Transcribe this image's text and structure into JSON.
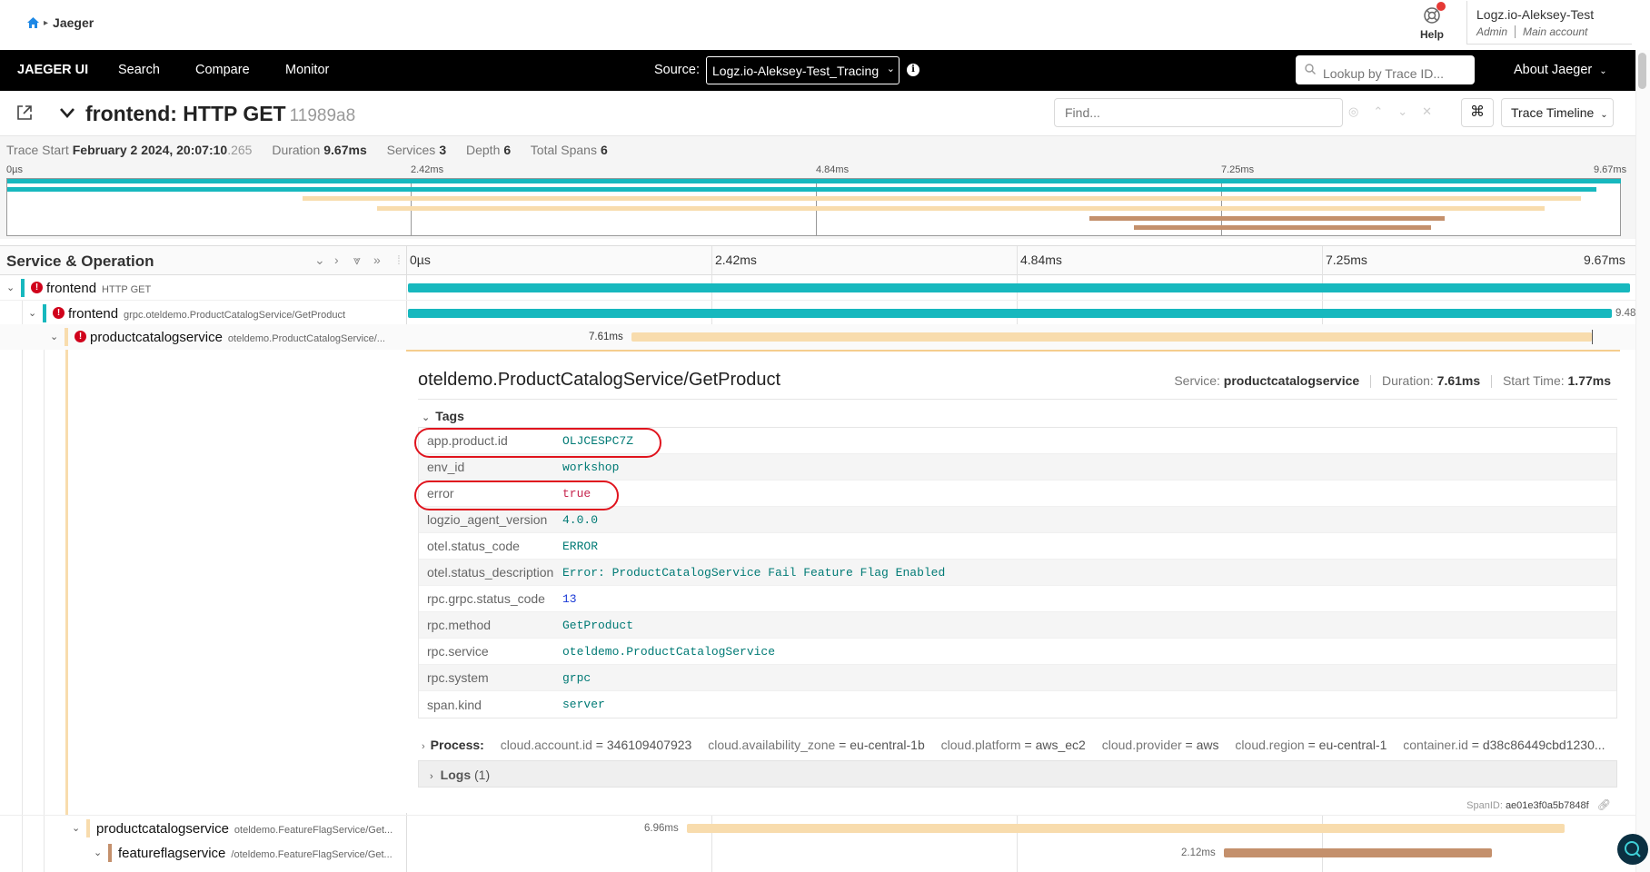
{
  "breadcrumb": {
    "home_icon": "home-icon",
    "label": "Jaeger"
  },
  "help": {
    "label": "Help",
    "icon": "lifebuoy-icon"
  },
  "account": {
    "name": "Logz.io-Aleksey-Test",
    "role": "Admin",
    "type": "Main account"
  },
  "nav": {
    "brand": "JAEGER UI",
    "items": [
      "Search",
      "Compare",
      "Monitor"
    ],
    "source_label": "Source:",
    "source_value": "Logz.io-Aleksey-Test_Tracing",
    "lookup_placeholder": "Lookup by Trace ID...",
    "about": "About Jaeger"
  },
  "trace": {
    "title": "frontend: HTTP GET",
    "id": "11989a8",
    "find_placeholder": "Find...",
    "view_mode": "Trace Timeline",
    "summary": {
      "start_label": "Trace Start",
      "start_value": "February 2 2024, 20:07:10",
      "start_ms": ".265",
      "duration_label": "Duration",
      "duration_value": "9.67ms",
      "services_label": "Services",
      "services_value": "3",
      "depth_label": "Depth",
      "depth_value": "6",
      "spans_label": "Total Spans",
      "spans_value": "6"
    },
    "ticks": [
      "0µs",
      "2.42ms",
      "4.84ms",
      "7.25ms",
      "9.67ms"
    ]
  },
  "colors": {
    "frontend": "#17b8be",
    "productcatalog": "#f8dcad",
    "featureflag": "#c4906c",
    "error": "#d0021b"
  },
  "table": {
    "header": "Service & Operation",
    "rows": [
      {
        "service": "frontend",
        "operation": "HTTP GET",
        "duration": ""
      },
      {
        "service": "frontend",
        "operation": "grpc.oteldemo.ProductCatalogService/GetProduct",
        "duration": "9.48"
      },
      {
        "service": "productcatalogservice",
        "operation": "oteldemo.ProductCatalogService/...",
        "duration": "7.61ms"
      },
      {
        "service": "productcatalogservice",
        "operation": "oteldemo.FeatureFlagService/Get...",
        "duration": "6.96ms"
      },
      {
        "service": "featureflagservice",
        "operation": "/oteldemo.FeatureFlagService/Get...",
        "duration": "2.12ms"
      }
    ]
  },
  "detail": {
    "title": "oteldemo.ProductCatalogService/GetProduct",
    "service_label": "Service:",
    "service_value": "productcatalogservice",
    "duration_label": "Duration:",
    "duration_value": "7.61ms",
    "start_label": "Start Time:",
    "start_value": "1.77ms",
    "tags_label": "Tags",
    "tags": [
      {
        "key": "app.product.id",
        "value": "OLJCESPC7Z"
      },
      {
        "key": "env_id",
        "value": "workshop"
      },
      {
        "key": "error",
        "value": "true"
      },
      {
        "key": "logzio_agent_version",
        "value": "4.0.0"
      },
      {
        "key": "otel.status_code",
        "value": "ERROR"
      },
      {
        "key": "otel.status_description",
        "value": "Error: ProductCatalogService Fail Feature Flag Enabled"
      },
      {
        "key": "rpc.grpc.status_code",
        "value": "13"
      },
      {
        "key": "rpc.method",
        "value": "GetProduct"
      },
      {
        "key": "rpc.service",
        "value": "oteldemo.ProductCatalogService"
      },
      {
        "key": "rpc.system",
        "value": "grpc"
      },
      {
        "key": "span.kind",
        "value": "server"
      }
    ],
    "process_label": "Process:",
    "process": [
      {
        "key": "cloud.account.id",
        "value": "346109407923"
      },
      {
        "key": "cloud.availability_zone",
        "value": "eu-central-1b"
      },
      {
        "key": "cloud.platform",
        "value": "aws_ec2"
      },
      {
        "key": "cloud.provider",
        "value": "aws"
      },
      {
        "key": "cloud.region",
        "value": "eu-central-1"
      },
      {
        "key": "container.id",
        "value": "d38c86449cbd1230..."
      }
    ],
    "logs_label": "Logs",
    "logs_count": "(1)",
    "spanid_label": "SpanID:",
    "spanid_value": "ae01e3f0a5b7848f"
  }
}
